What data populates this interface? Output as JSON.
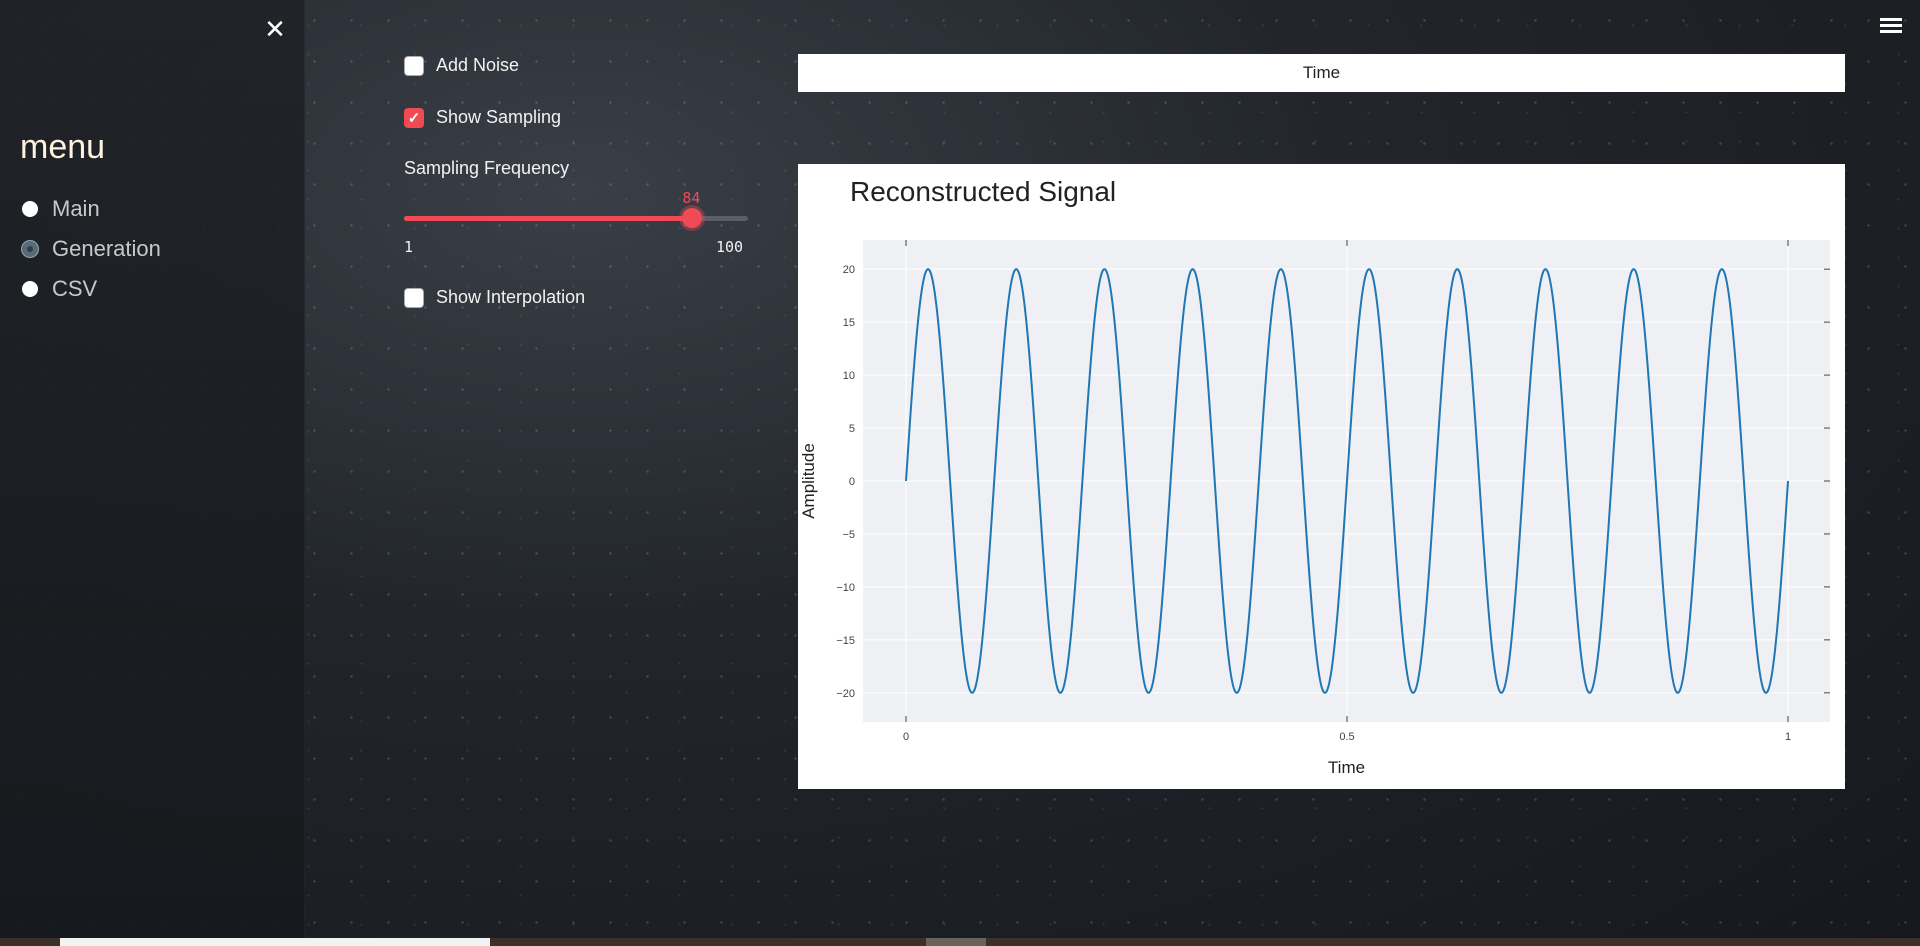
{
  "sidebar": {
    "close_icon": "close-icon",
    "menu_title": "menu",
    "items": [
      {
        "label": "Main",
        "selected": false
      },
      {
        "label": "Generation",
        "selected": true
      },
      {
        "label": "CSV",
        "selected": false
      }
    ]
  },
  "controls": {
    "add_noise": {
      "label": "Add Noise",
      "checked": false
    },
    "show_sampling": {
      "label": "Show Sampling",
      "checked": true
    },
    "sampling_frequency": {
      "label": "Sampling Frequency",
      "value": 84,
      "min": 1,
      "max": 100,
      "min_label": "1",
      "max_label": "100",
      "value_label": "84"
    },
    "show_interpolation": {
      "label": "Show Interpolation",
      "checked": false
    }
  },
  "top_chart": {
    "xlabel": "Time"
  },
  "chart_data": {
    "type": "line",
    "title": "Reconstructed Signal",
    "xlabel": "Time",
    "ylabel": "Amplitude",
    "xlim": [
      0,
      1
    ],
    "ylim": [
      -22,
      22
    ],
    "x_ticks": [
      0,
      0.5,
      1
    ],
    "x_tick_labels": [
      "0",
      "0.5",
      "1"
    ],
    "y_ticks": [
      20,
      15,
      10,
      5,
      0,
      -5,
      -10,
      -15,
      -20
    ],
    "y_tick_labels": [
      "20",
      "15",
      "10",
      "5",
      "0",
      "−5",
      "−10",
      "−15",
      "−20"
    ],
    "grid": true,
    "series": [
      {
        "amplitude": 20,
        "frequency": 10,
        "color": "#1f77b4"
      }
    ],
    "plot_bg": "#eef0f4"
  },
  "colors": {
    "accent": "#f04b55",
    "line": "#1f77b4"
  }
}
